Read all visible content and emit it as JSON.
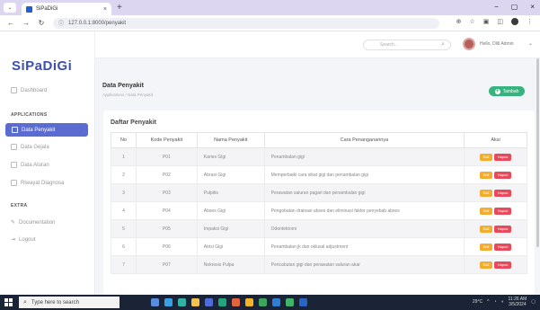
{
  "browser": {
    "tab_title": "SiPaDiGi",
    "tab_close": "×",
    "new_tab": "+",
    "url": "127.0.0.1:8000/penyakit",
    "win_min": "−",
    "win_max": "▢",
    "win_close": "×"
  },
  "sidebar": {
    "brand": "SiPaDiGi",
    "dashboard": "Dashboard",
    "section_applications": "APPLICATIONS",
    "active_item": "Data Penyakit",
    "items": [
      "Data Gejala",
      "Data Aturan",
      "Riwayat Diagnosa"
    ],
    "section_extra": "EXTRA",
    "extra_items": [
      "Documentation",
      "Logout"
    ]
  },
  "topbar": {
    "search_placeholder": "Search...",
    "user_name": "Hello, Dilli Admin"
  },
  "page": {
    "title": "Data Penyakit",
    "breadcrumb": "Applications  /  Data Penyakit",
    "add_button": "Tambah"
  },
  "table": {
    "card_title": "Daftar Penyakit",
    "headers": [
      "No",
      "Kode Penyakit",
      "Nama Penyakit",
      "Cara Penanganannya",
      "Aksi"
    ],
    "edit_label": "Edit",
    "delete_label": "Hapus",
    "rows": [
      [
        "1",
        "P01",
        "Karies Gigi",
        "Penambalan gigi"
      ],
      [
        "2",
        "P02",
        "Abrasi Gigi",
        "Memperbaiki cara sikat gigi dan penambalan gigi"
      ],
      [
        "3",
        "P03",
        "Pulpitis",
        "Perawatan saluran pagari dan penambalan gigi"
      ],
      [
        "4",
        "P04",
        "Abses Gigi",
        "Pengobatan drainasi abses dan eliminasi faktor penyebab abses"
      ],
      [
        "5",
        "P05",
        "Impaksi Gigi",
        "Odontektomi"
      ],
      [
        "6",
        "P06",
        "Atrisi Gigi",
        "Penambalan jk dan oklusal adjustment"
      ],
      [
        "7",
        "P07",
        "Nekrosis Pulpa",
        "Pencabutan gigi dan perawatan saluran akar"
      ]
    ]
  },
  "taskbar": {
    "search_placeholder": "Type here to search",
    "weather": "29°C",
    "time": "11:26 AM",
    "date": "3/5/2024"
  },
  "colors": {
    "brand": "#3a4fb0",
    "sidebar_active": "#5a6cd1",
    "add_button": "#36b37e",
    "edit_button": "#f0ad2e",
    "delete_button": "#e74a5b"
  }
}
